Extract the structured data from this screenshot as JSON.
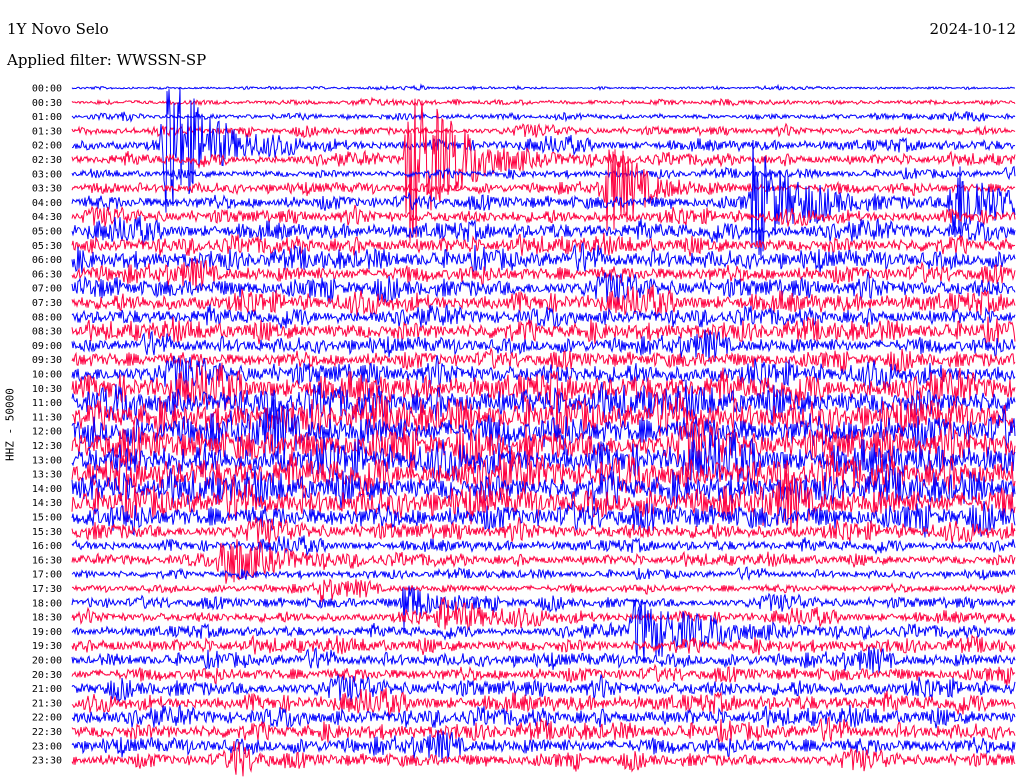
{
  "header": {
    "station": "1Y Novo Selo",
    "filter": "Applied filter: WWSSN-SP",
    "date": "2024-10-12"
  },
  "colors": {
    "even_trace": "#0000ff",
    "odd_trace": "#ff0040"
  },
  "chart_data": {
    "type": "line",
    "title": "1Y Novo Selo",
    "ylabel": "HHZ - 50000",
    "xlabel": "",
    "x_unit": "minutes within 30-minute line",
    "xlim": [
      0,
      30
    ],
    "row_labels": [
      "00:00",
      "00:30",
      "01:00",
      "01:30",
      "02:00",
      "02:30",
      "03:00",
      "03:30",
      "04:00",
      "04:30",
      "05:00",
      "05:30",
      "06:00",
      "06:30",
      "07:00",
      "07:30",
      "08:00",
      "08:30",
      "09:00",
      "09:30",
      "10:00",
      "10:30",
      "11:00",
      "11:30",
      "12:00",
      "12:30",
      "13:00",
      "13:30",
      "14:00",
      "14:30",
      "15:00",
      "15:30",
      "16:00",
      "16:30",
      "17:00",
      "17:30",
      "18:00",
      "18:30",
      "19:00",
      "19:30",
      "20:00",
      "20:30",
      "21:00",
      "21:30",
      "22:00",
      "22:30",
      "23:00",
      "23:30"
    ],
    "noise_level": [
      1,
      1.5,
      2,
      3,
      4,
      4,
      3,
      4,
      5,
      5,
      6,
      6,
      7,
      6,
      7,
      7,
      6,
      7,
      6,
      6,
      8,
      10,
      11,
      12,
      12,
      12,
      12,
      12,
      11,
      11,
      9,
      6,
      4,
      4,
      3,
      3,
      4,
      4,
      4,
      5,
      5,
      5,
      6,
      6,
      6,
      6,
      6,
      5
    ],
    "events": [
      {
        "row": 4,
        "minute": 2.9,
        "amplitude": 90,
        "duration": 1.2
      },
      {
        "row": 5,
        "minute": 10.6,
        "amplitude": 95,
        "duration": 1.4
      },
      {
        "row": 7,
        "minute": 17.0,
        "amplitude": 45,
        "duration": 1.0
      },
      {
        "row": 8,
        "minute": 21.6,
        "amplitude": 60,
        "duration": 1.2
      },
      {
        "row": 8,
        "minute": 27.9,
        "amplitude": 50,
        "duration": 1.2
      },
      {
        "row": 33,
        "minute": 4.7,
        "amplitude": 30,
        "duration": 1.5
      },
      {
        "row": 35,
        "minute": 7.9,
        "amplitude": 12,
        "duration": 0.5
      },
      {
        "row": 36,
        "minute": 10.5,
        "amplitude": 25,
        "duration": 0.8
      },
      {
        "row": 37,
        "minute": 11.7,
        "amplitude": 18,
        "duration": 1.5
      },
      {
        "row": 38,
        "minute": 17.8,
        "amplitude": 35,
        "duration": 2.0
      },
      {
        "row": 47,
        "minute": 5.1,
        "amplitude": 20,
        "duration": 0.5
      }
    ]
  }
}
